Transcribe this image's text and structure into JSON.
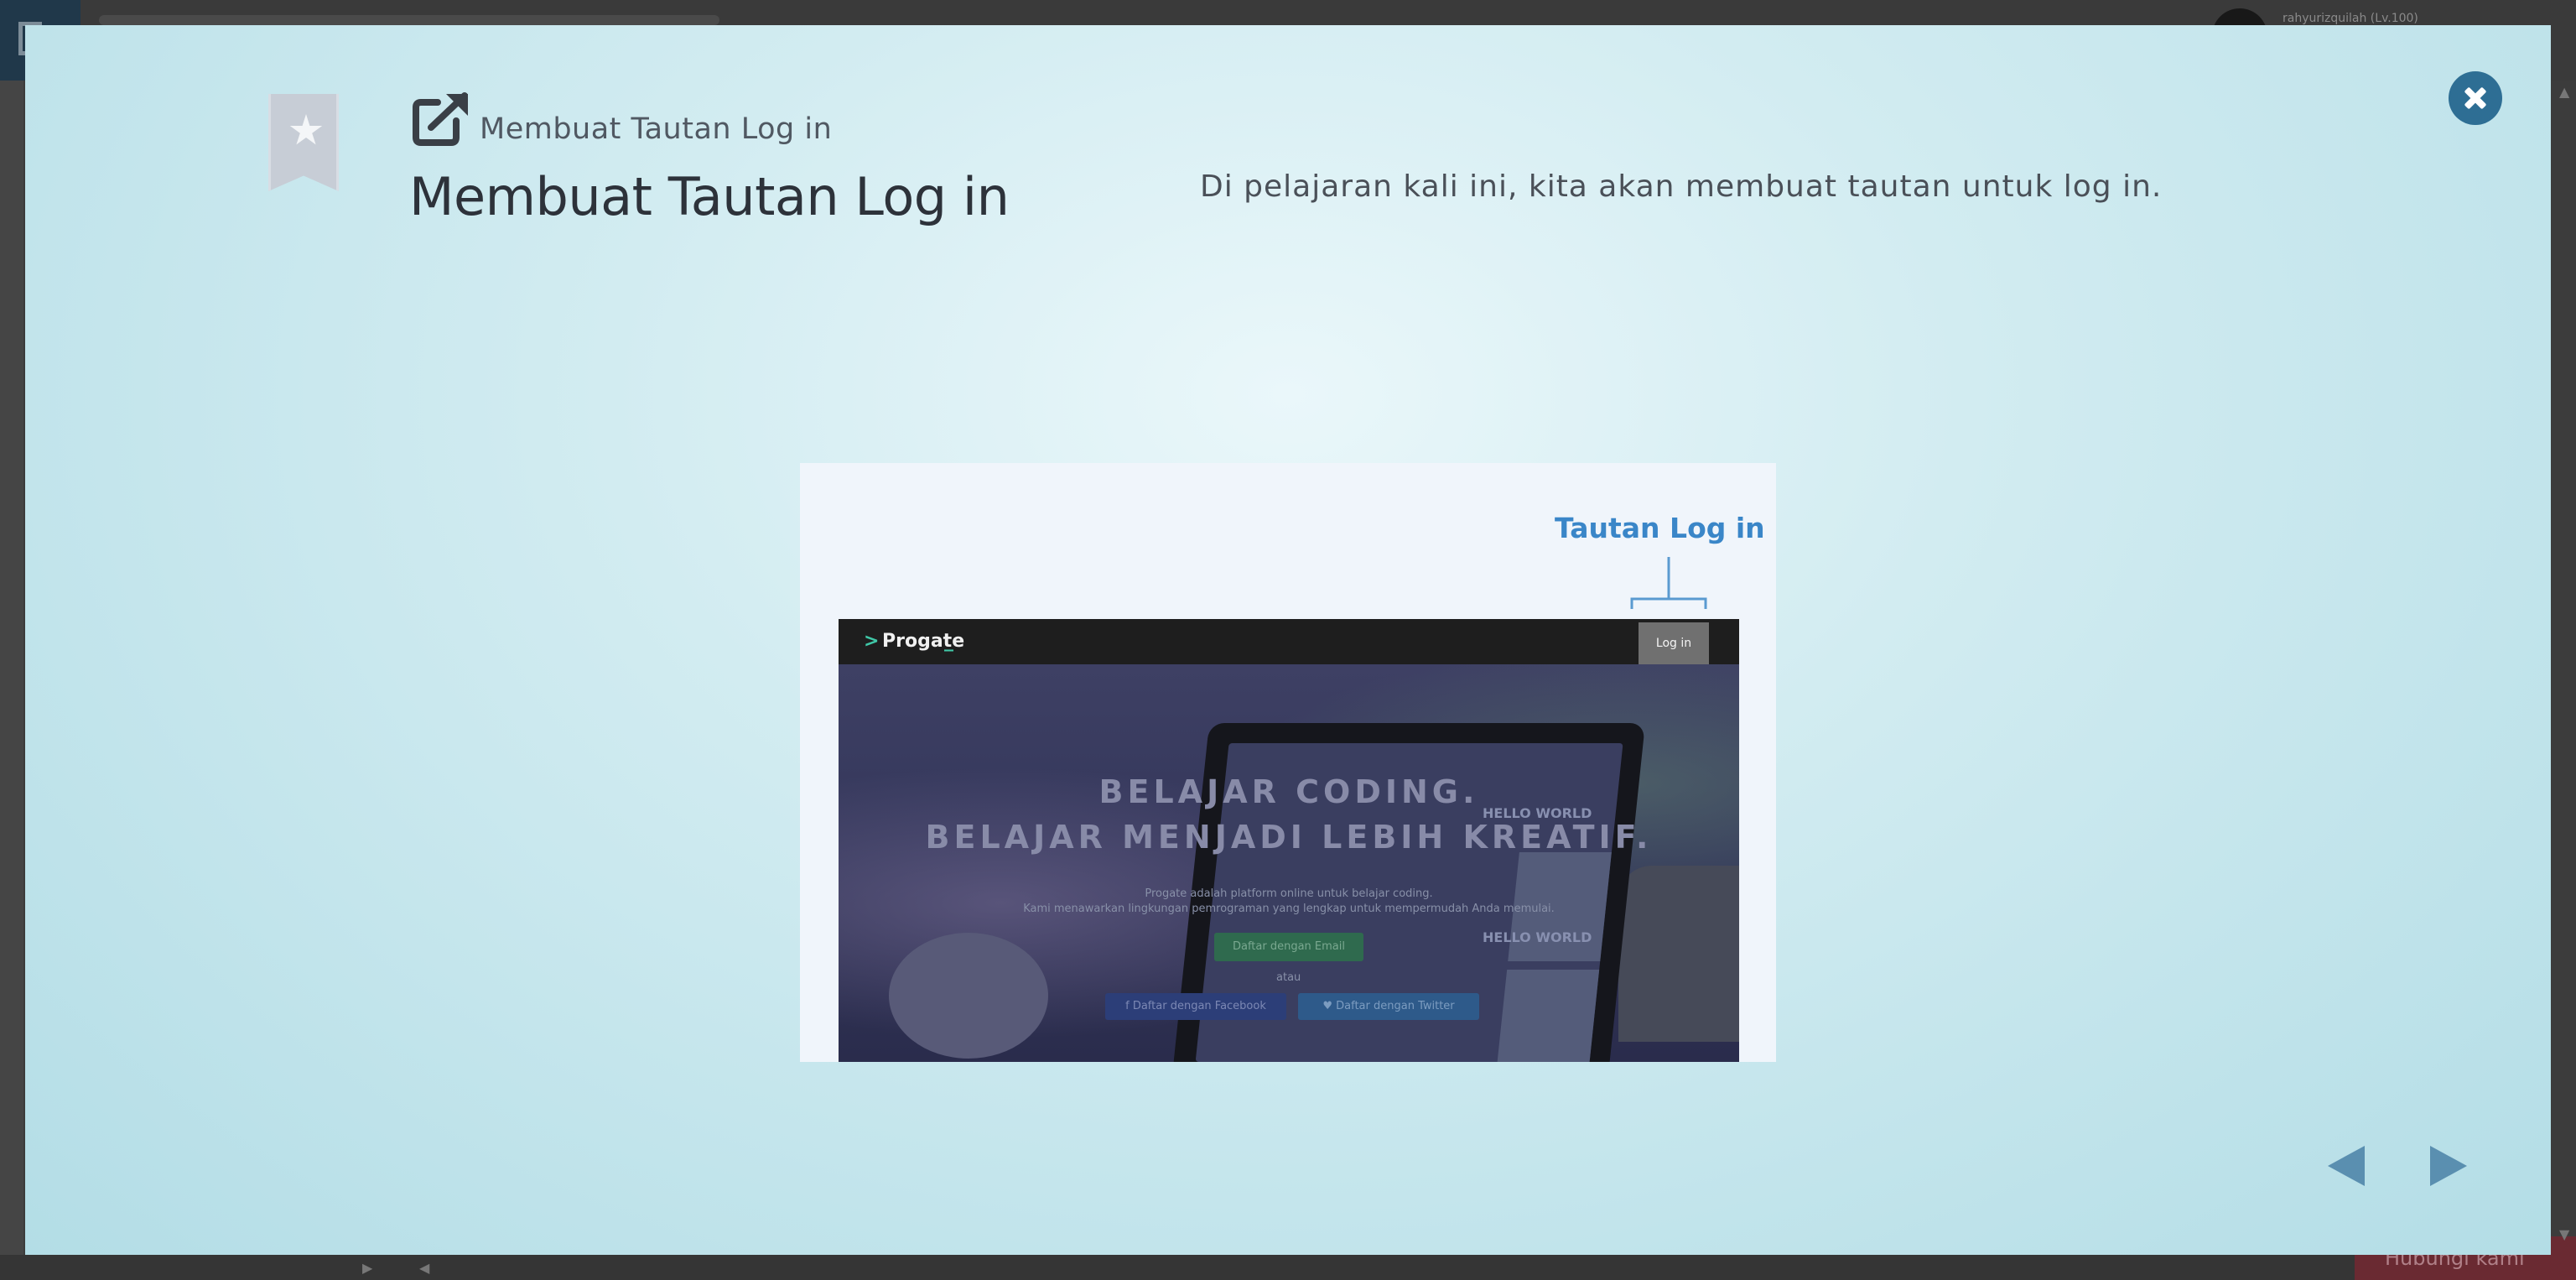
{
  "background_app": {
    "username": "rahyurizquilah (Lv.100)",
    "bottom_button_label": "Hubungi kami"
  },
  "modal": {
    "subtitle": "Membuat Tautan Log in",
    "title": "Membuat Tautan Log in",
    "description": "Di pelajaran kali ini, kita akan membuat tautan untuk log in.",
    "icons": {
      "bookmark": "bookmark-star-icon",
      "subtitle": "external-link-icon",
      "close": "close-icon",
      "prev": "arrow-left-icon",
      "next": "arrow-right-icon"
    },
    "colors": {
      "accent": "#2e6e94",
      "nav_arrow": "#5a8fb0",
      "callout": "#3a86c8"
    }
  },
  "illustration": {
    "callout_label": "Tautan Log in",
    "mock_site": {
      "brand_chevron": ">",
      "brand": "Progate",
      "brand_cursor": "_",
      "login_button": "Log in",
      "heading_line1": "BELAJAR CODING.",
      "heading_line2": "BELAJAR MENJADI LEBIH KREATIF.",
      "sub_line1": "Progate adalah platform online untuk belajar coding.",
      "sub_line2": "Kami menawarkan lingkungan pemrograman yang lengkap untuk mempermudah Anda memulai.",
      "email_button": "Daftar dengan Email",
      "or_text": "atau",
      "facebook_button": "f  Daftar dengan Facebook",
      "twitter_button": "♥  Daftar dengan Twitter",
      "screen_text_1": "HELLO WORLD",
      "screen_text_2": "HELLO WORLD"
    }
  }
}
